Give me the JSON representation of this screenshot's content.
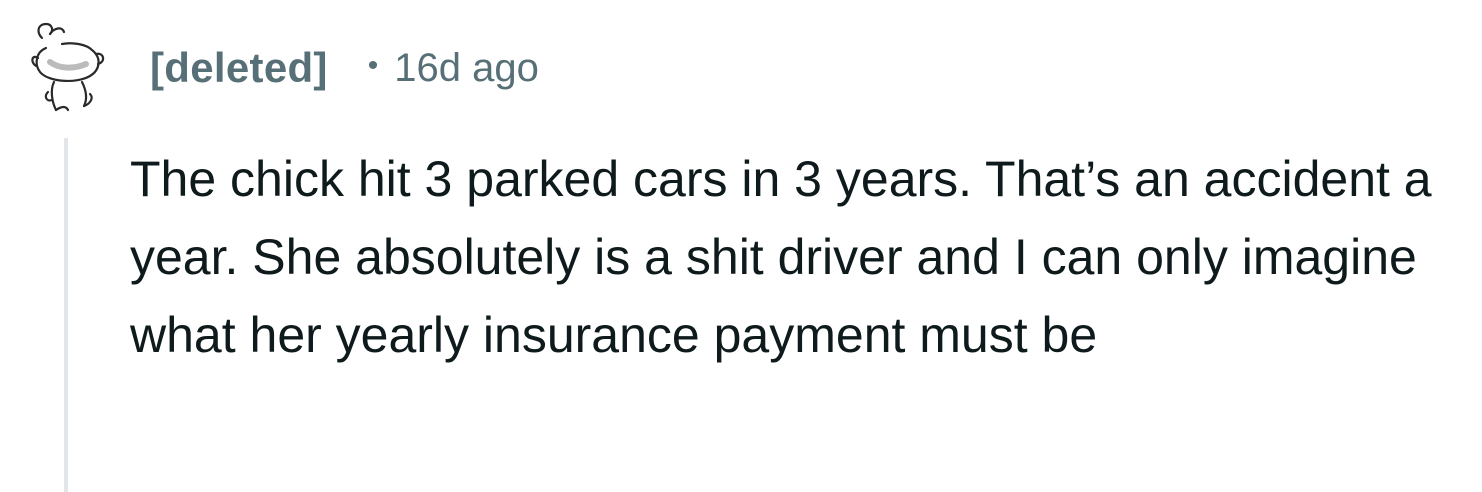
{
  "comment": {
    "author": "[deleted]",
    "separator": "•",
    "timestamp": "16d ago",
    "avatar_icon": "deleted-user-snoo-icon",
    "body": "The chick hit 3 parked cars in 3 years. That’s an accident a year. She absolutely is a shit driver and I can only imagine what her yearly insurance payment must be"
  },
  "colors": {
    "meta": "#576f76",
    "text": "#0f1a1c",
    "thread_line": "#e3e6e8",
    "background": "#ffffff"
  }
}
